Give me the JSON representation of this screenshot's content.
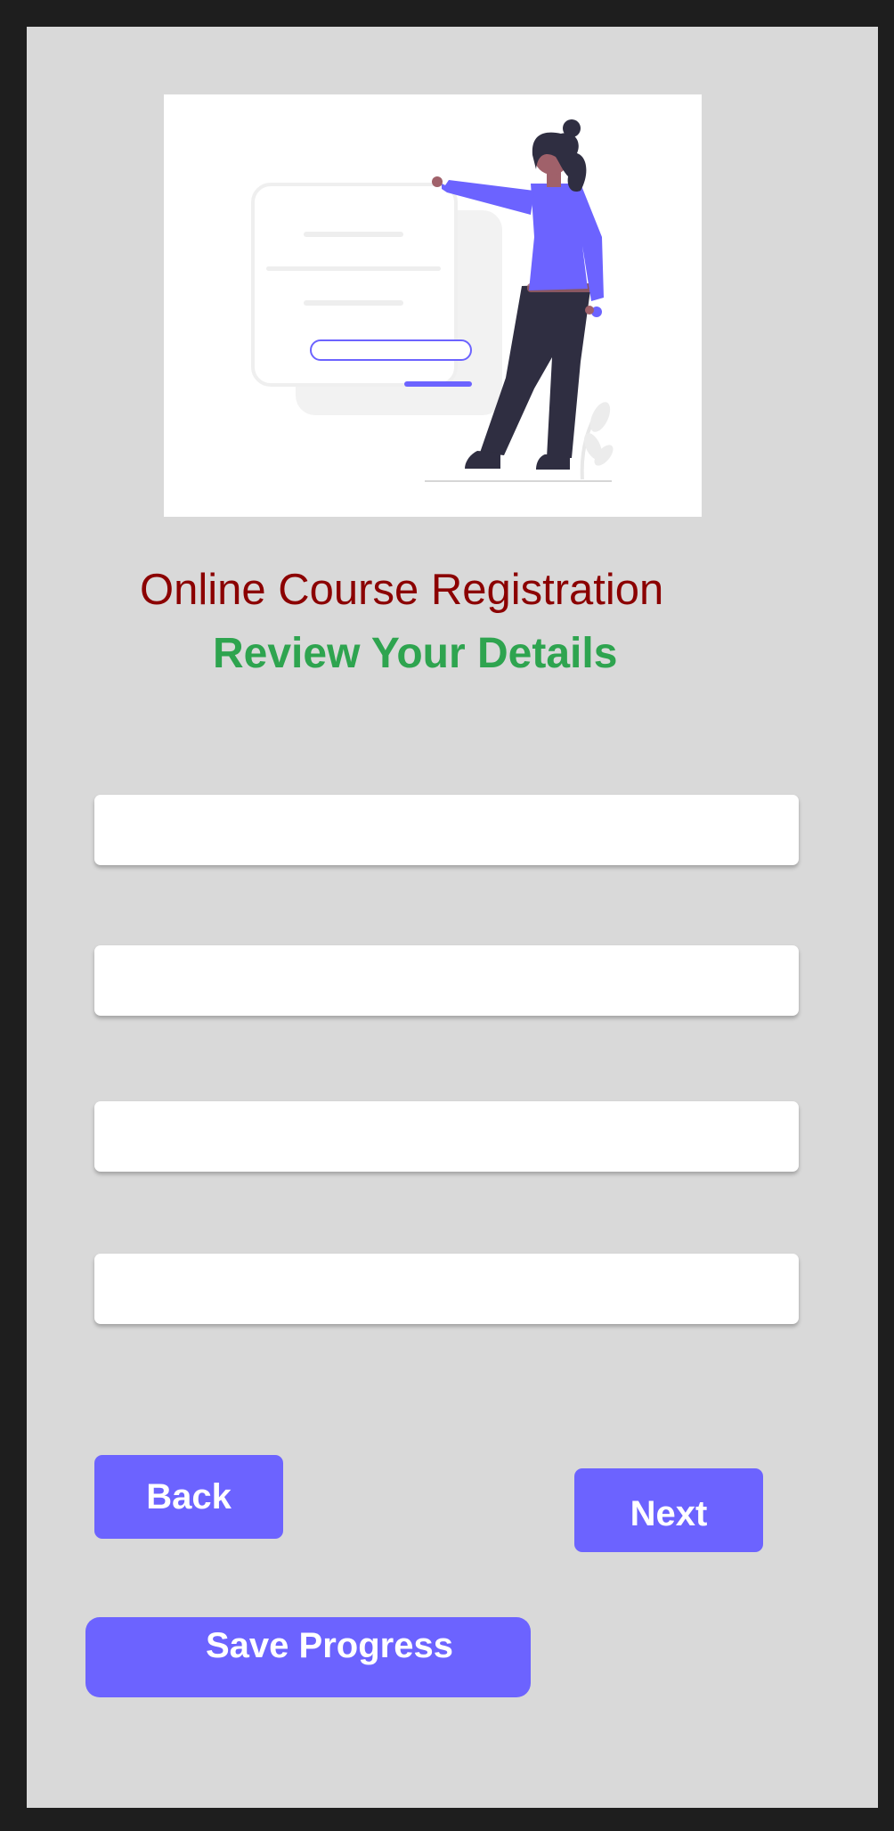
{
  "page": {
    "title": "Online Course Registration",
    "subtitle": "Review Your Details"
  },
  "illustration": {
    "icon": "person-with-form-illustration"
  },
  "form": {
    "fields": [
      {
        "value": "",
        "placeholder": ""
      },
      {
        "value": "",
        "placeholder": ""
      },
      {
        "value": "",
        "placeholder": ""
      },
      {
        "value": "",
        "placeholder": ""
      }
    ]
  },
  "buttons": {
    "back": "Back",
    "next": "Next",
    "save": "Save Progress"
  },
  "colors": {
    "title": "#8b0000",
    "subtitle": "#2ea44f",
    "accent": "#6c63ff",
    "panel_background": "#d9d9d9",
    "outer_background": "#1e1e1e"
  }
}
